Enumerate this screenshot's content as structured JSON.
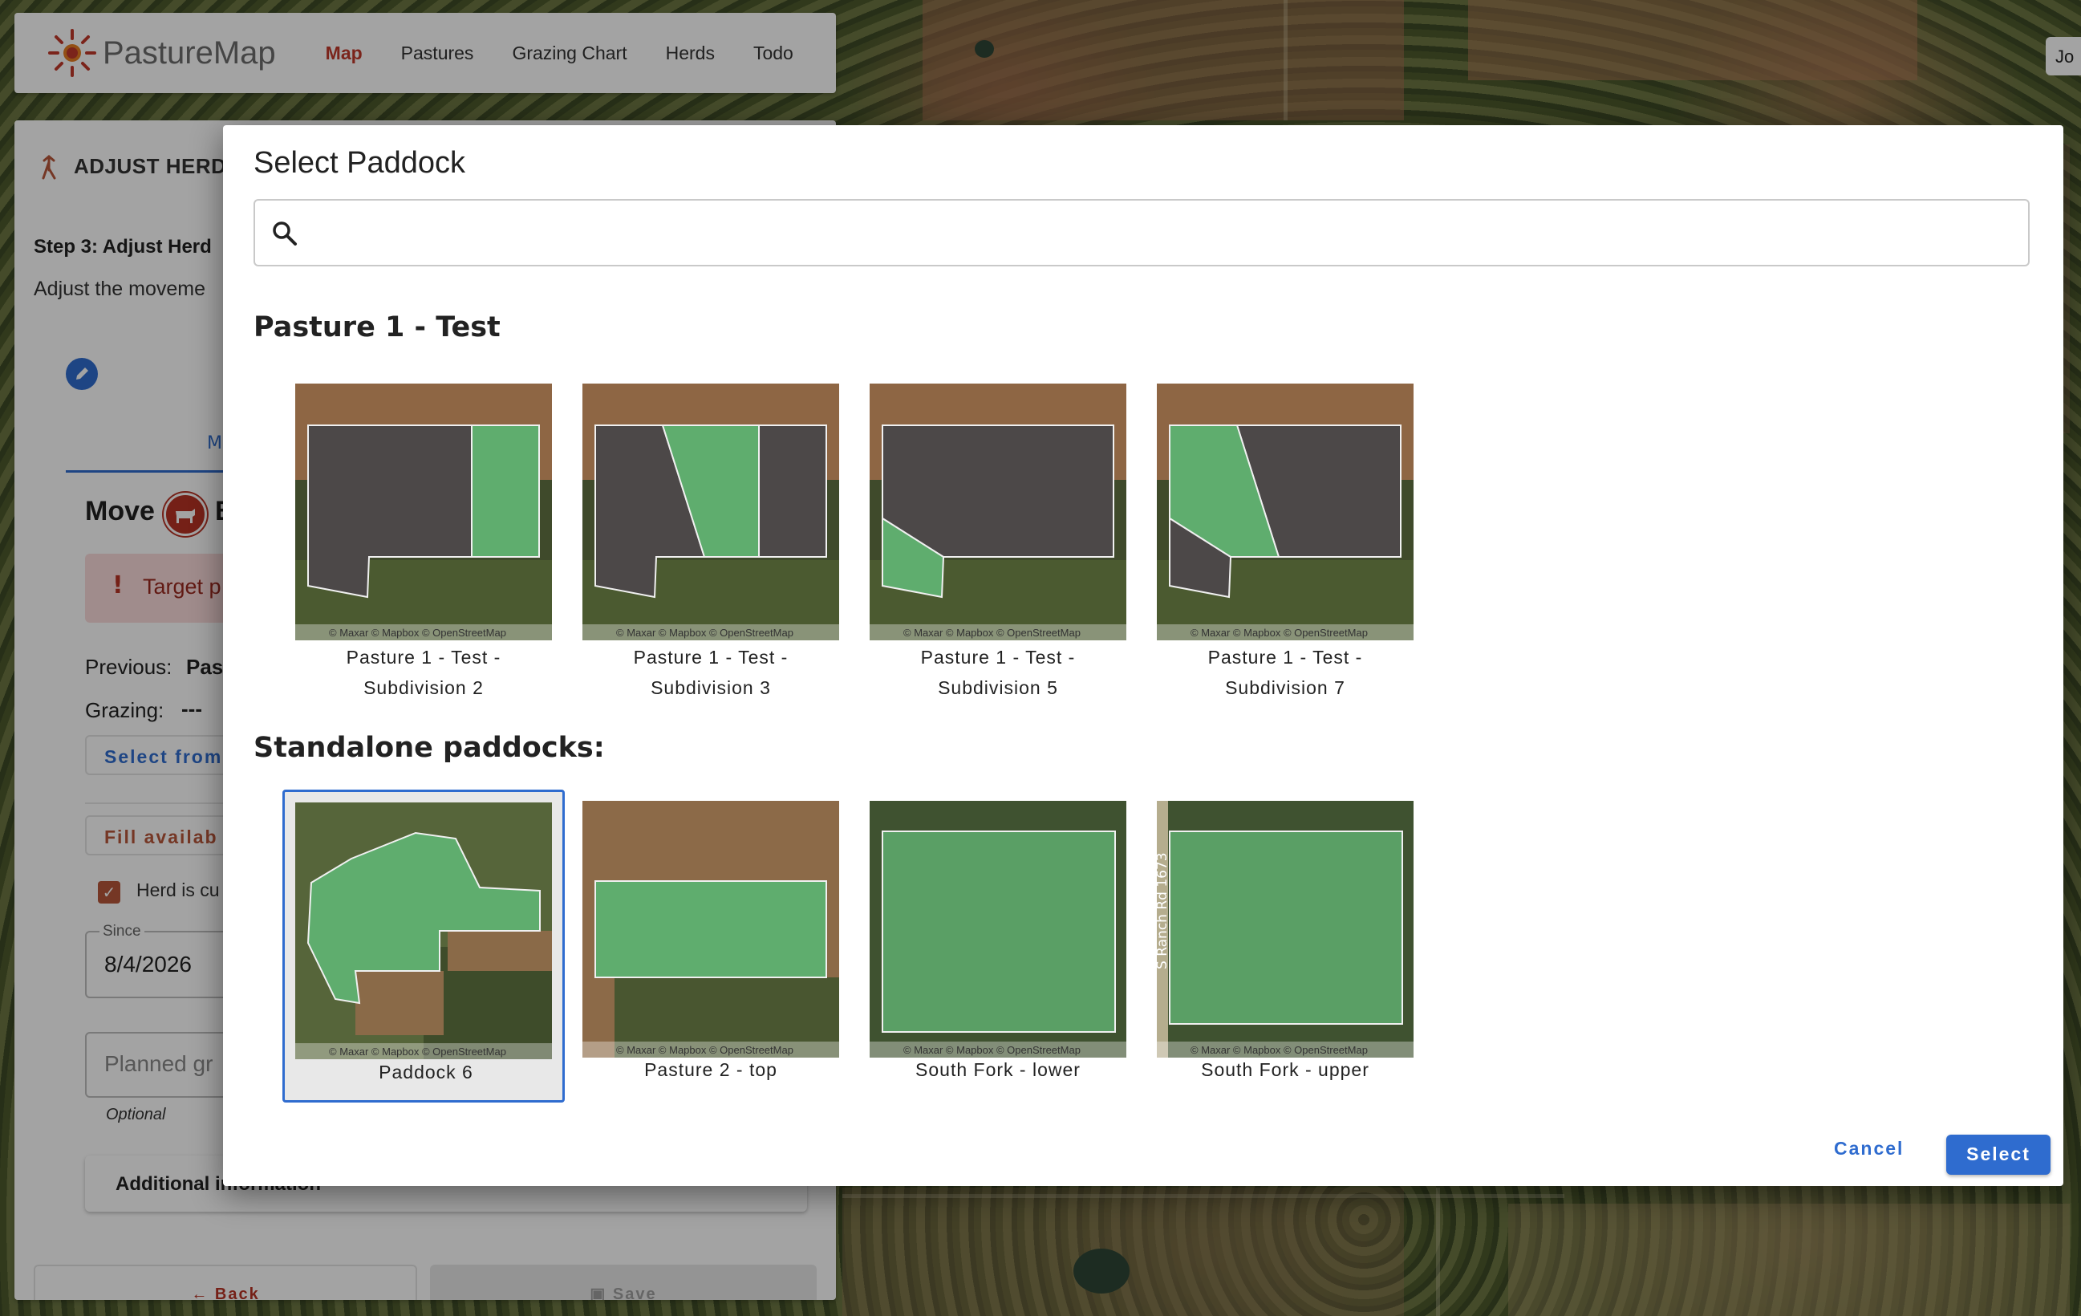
{
  "app": {
    "brand": "PastureMap",
    "nav": [
      {
        "label": "Map",
        "active": true
      },
      {
        "label": "Pastures",
        "active": false
      },
      {
        "label": "Grazing Chart",
        "active": false
      },
      {
        "label": "Herds",
        "active": false
      },
      {
        "label": "Todo",
        "active": false
      }
    ],
    "user_initials": "Jo"
  },
  "panel": {
    "title": "ADJUST HERD",
    "step_title": "Step 3: Adjust Herd",
    "step_desc": "Adjust the moveme",
    "tab_label": "M",
    "move_label": "Move",
    "herd_letter": "B",
    "alert_icon": "!",
    "alert_text": "Target p",
    "previous_label": "Previous:",
    "previous_value": "Pas",
    "grazing_label": "Grazing:",
    "grazing_value": "---",
    "select_from_label": "Select from",
    "fill_available_label": "Fill availab",
    "herd_checkbox_label": "Herd is cu",
    "since_label": "Since",
    "since_value": "8/4/2026",
    "planned_placeholder": "Planned gr",
    "optional_label": "Optional",
    "additional_info_label": "Additional information",
    "back_label": "Back",
    "save_label": "Save",
    "colors": {
      "accent_red": "#b83224",
      "accent_blue": "#2f6ccf"
    }
  },
  "modal": {
    "title": "Select Paddock",
    "search_placeholder": "",
    "sections": [
      {
        "title": "Pasture 1 - Test",
        "items": [
          {
            "line1": "Pasture 1 - Test -",
            "line2": "Subdivision 2"
          },
          {
            "line1": "Pasture 1 - Test -",
            "line2": "Subdivision 3"
          },
          {
            "line1": "Pasture 1 - Test -",
            "line2": "Subdivision 5"
          },
          {
            "line1": "Pasture 1 - Test -",
            "line2": "Subdivision 7"
          }
        ]
      },
      {
        "title": "Standalone paddocks:",
        "items": [
          {
            "line1": "Paddock 6",
            "selected": true
          },
          {
            "line1": "Pasture 2 - top",
            "selected": false
          },
          {
            "line1": "South Fork - lower",
            "selected": false
          },
          {
            "line1": "South Fork - upper",
            "selected": false
          }
        ]
      }
    ],
    "map_credit": "© Maxar © Mapbox © OpenStreetMap",
    "road_label": "S Ranch Rd 1673",
    "cancel_label": "Cancel",
    "select_label": "Select",
    "colors": {
      "paddock_fill": "#5fad6e",
      "selection_border": "#2f6ccf"
    }
  }
}
